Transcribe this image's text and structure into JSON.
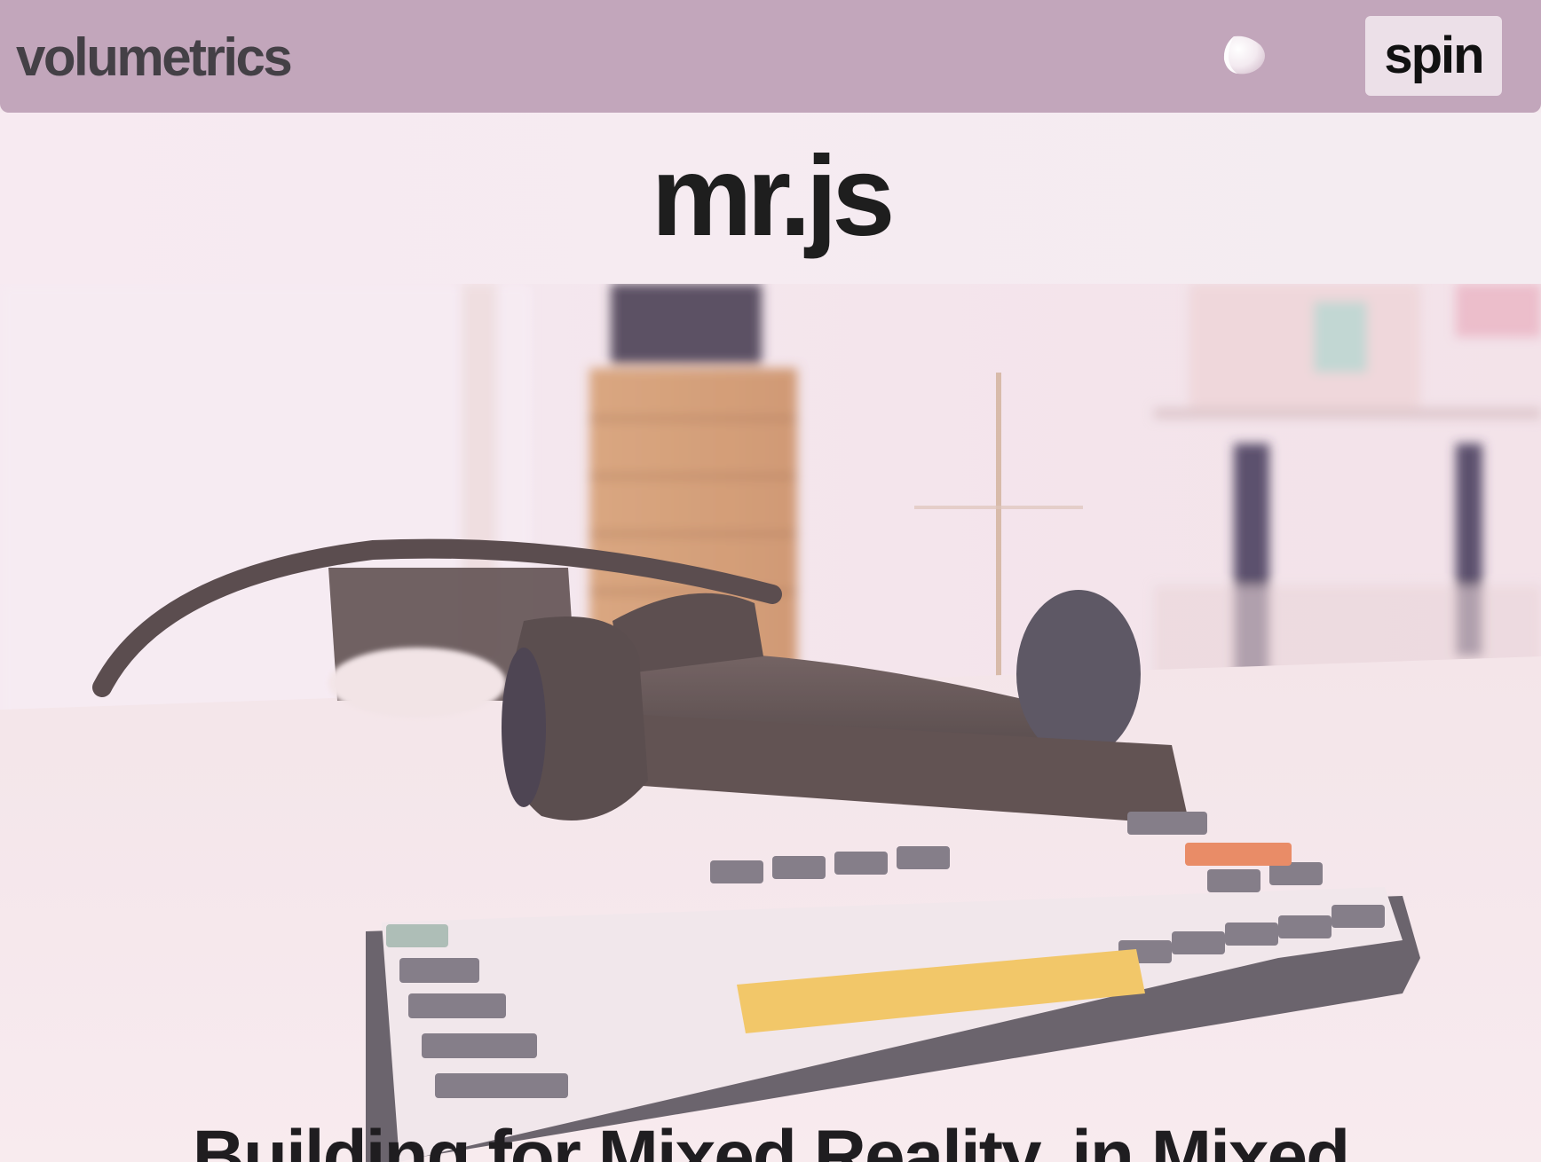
{
  "header": {
    "brand": "volumetrics",
    "spin_label": "spin",
    "orb_icon": "spin-orb-icon"
  },
  "title": "mr.js",
  "hero": {
    "heading": "Building for Mixed Reality, in Mixed",
    "image_subject": "headset-keyboard-photo"
  },
  "colors": {
    "topbar": "#c2a6bb",
    "titleband": "#f6ebf1",
    "spin_button": "#ece0e8",
    "text_dark": "#1e1e1e",
    "brand_text": "#444046"
  }
}
